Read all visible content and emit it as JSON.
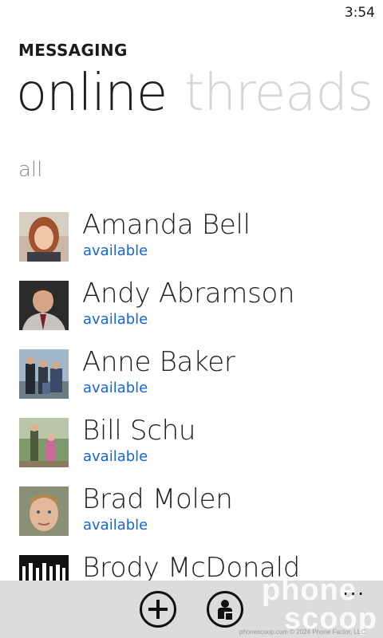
{
  "status_bar": {
    "time": "3:54"
  },
  "app": {
    "title": "MESSAGING"
  },
  "pivot": {
    "active": "online",
    "inactive": "threads"
  },
  "group_header": "all",
  "contacts": [
    {
      "name": "Amanda Bell",
      "status": "available",
      "avatar": "avatar-amanda"
    },
    {
      "name": "Andy Abramson",
      "status": "available",
      "avatar": "avatar-andy"
    },
    {
      "name": "Anne Baker",
      "status": "available",
      "avatar": "avatar-anne"
    },
    {
      "name": "Bill Schu",
      "status": "available",
      "avatar": "avatar-bill"
    },
    {
      "name": "Brad Molen",
      "status": "available",
      "avatar": "avatar-brad"
    },
    {
      "name": "Brody McDonald",
      "status": "",
      "avatar": "avatar-brody"
    }
  ],
  "app_bar": {
    "buttons": [
      {
        "icon": "add-icon"
      },
      {
        "icon": "person-status-icon"
      }
    ],
    "more": "..."
  },
  "watermark": {
    "line1": "phone",
    "line2": "scoop"
  },
  "footer": "phonescoop.com  © 2024 Phone Factor, LLC",
  "colors": {
    "accent": "#1565d8",
    "app_bar_bg": "#dcdcdc",
    "inactive_pivot": "#d6d6d6"
  }
}
